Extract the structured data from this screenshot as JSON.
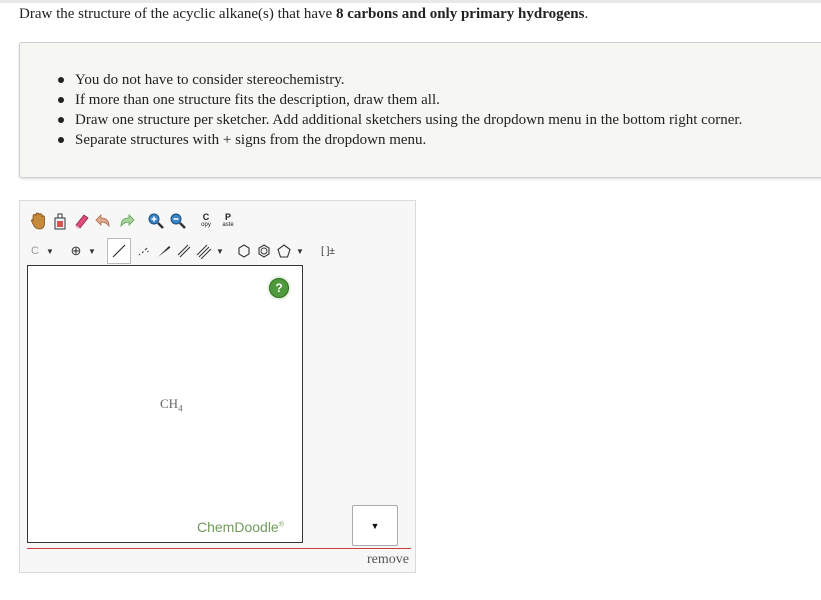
{
  "question": {
    "prefix": "Draw the structure of the acyclic alkane(s) that have ",
    "bold": "8 carbons and only primary hydrogens",
    "suffix": "."
  },
  "instructions": [
    "You do not have to consider stereochemistry.",
    "If more than one structure fits the description, draw them all.",
    "Draw one structure per sketcher. Add additional sketchers using the dropdown menu in the bottom right corner.",
    "Separate structures with + signs from the dropdown menu."
  ],
  "toolbar": {
    "copy_top": "C",
    "copy_bottom": "opy",
    "paste_top": "P",
    "paste_bottom": "aste",
    "element_label": "C",
    "charge_label": "⊕",
    "bracket_label": "[ ]±"
  },
  "canvas": {
    "atom_main": "CH",
    "atom_sub": "4",
    "help_label": "?",
    "brand": "ChemDoodle",
    "brand_mark": "®"
  },
  "dropdown": {
    "arrow": "▼"
  },
  "remove_label": "remove",
  "colors": {
    "help_green": "#4f9a3c",
    "brand_green": "#6f9a5c",
    "divider_red": "#c9403d"
  }
}
